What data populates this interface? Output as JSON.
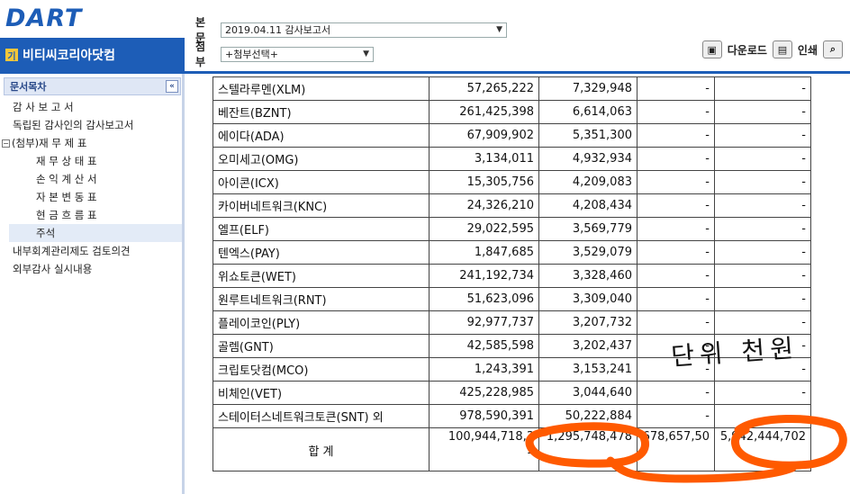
{
  "header": {
    "logo": "DART",
    "company": "비티씨코리아닷컴",
    "company_badge": "기",
    "main_label": "본문",
    "main_select": "2019.04.11  감사보고서",
    "attach_label": "첨부",
    "attach_select": "+첨부선택+",
    "download": "다운로드",
    "print": "인쇄"
  },
  "sidebar": {
    "title": "문서목차",
    "items": [
      {
        "label": "감 사 보 고 서",
        "level": 0
      },
      {
        "label": "독립된 감사인의 감사보고서",
        "level": 0
      },
      {
        "label": "(첨부)재 무 제 표",
        "level": 0
      },
      {
        "label": "재 무 상 태 표",
        "level": 1
      },
      {
        "label": "손 익 계 산 서",
        "level": 1
      },
      {
        "label": "자 본 변 동 표",
        "level": 1
      },
      {
        "label": "현 금 흐 름 표",
        "level": 1
      },
      {
        "label": "주석",
        "level": 1
      },
      {
        "label": "내부회계관리제도 검토의견",
        "level": 0
      },
      {
        "label": "외부감사 실시내용",
        "level": 0
      }
    ]
  },
  "table": {
    "rows": [
      [
        "스텔라루멘(XLM)",
        "57,265,222",
        "7,329,948",
        "-",
        "-"
      ],
      [
        "베잔트(BZNT)",
        "261,425,398",
        "6,614,063",
        "-",
        "-"
      ],
      [
        "에이다(ADA)",
        "67,909,902",
        "5,351,300",
        "-",
        "-"
      ],
      [
        "오미세고(OMG)",
        "3,134,011",
        "4,932,934",
        "-",
        "-"
      ],
      [
        "아이콘(ICX)",
        "15,305,756",
        "4,209,083",
        "-",
        "-"
      ],
      [
        "카이버네트워크(KNC)",
        "24,326,210",
        "4,208,434",
        "-",
        "-"
      ],
      [
        "엘프(ELF)",
        "29,022,595",
        "3,569,779",
        "-",
        "-"
      ],
      [
        "텐엑스(PAY)",
        "1,847,685",
        "3,529,079",
        "-",
        "-"
      ],
      [
        "위쇼토큰(WET)",
        "241,192,734",
        "3,328,460",
        "-",
        "-"
      ],
      [
        "원루트네트워크(RNT)",
        "51,623,096",
        "3,309,040",
        "-",
        "-"
      ],
      [
        "플레이코인(PLY)",
        "92,977,737",
        "3,207,732",
        "-",
        "-"
      ],
      [
        "골렘(GNT)",
        "42,585,598",
        "3,202,437",
        "-",
        "-"
      ],
      [
        "크립토닷컴(MCO)",
        "1,243,391",
        "3,153,241",
        "-",
        "-"
      ],
      [
        "비체인(VET)",
        "425,228,985",
        "3,044,640",
        "-",
        "-"
      ],
      [
        "스테이터스네트워크토큰(SNT) 외",
        "978,590,391",
        "50,222,884",
        "-",
        "-"
      ]
    ],
    "total": [
      "합 계",
      "100,944,718,3",
      "1,295,748,478",
      "678,657,50",
      "5,942,444,702"
    ],
    "total_wrap": "1"
  },
  "annotation": {
    "handwriting": "단위 천원",
    "marker_color": "#ff5a00"
  }
}
